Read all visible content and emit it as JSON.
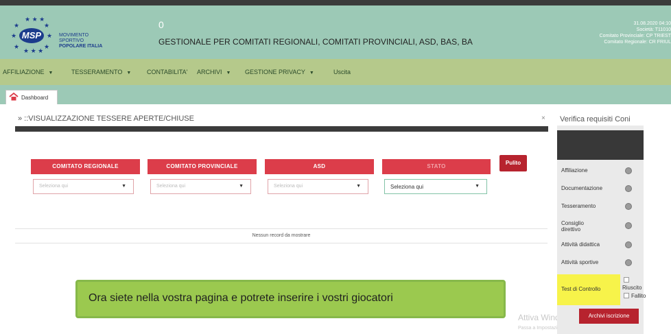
{
  "header": {
    "logo": {
      "mark": "MSP",
      "lines": [
        "MOVIMENTO",
        "SPORTIVO",
        "POPOLARE ITALIA"
      ]
    },
    "count": "0",
    "title": "GESTIONALE PER COMITATI REGIONALI, COMITATI PROVINCIALI, ASD, BAS, BA",
    "right_lines": [
      "31.08.2020 04:10",
      "Società: T11010",
      "Comitato Provinciale: CP TRIEST",
      "Comitato Regionale: CR FRIUL"
    ]
  },
  "nav": {
    "items": [
      {
        "label": "AFFILIAZIONE",
        "caret": "▼"
      },
      {
        "label": "TESSERAMENTO",
        "caret": "▼"
      },
      {
        "label": "CONTABILITA'",
        "caret": ""
      },
      {
        "label": "ARCHIVI",
        "caret": "▼"
      },
      {
        "label": "GESTIONE PRIVACY",
        "caret": "▼"
      },
      {
        "label": "Uscita",
        "caret": ""
      }
    ]
  },
  "tabs": {
    "dashboard": "Dashboard"
  },
  "main": {
    "title": "» ::VISUALIZZAZIONE TESSERE APERTE/CHIUSE",
    "close": "×",
    "filters": [
      {
        "header": "COMITATO REGIONALE",
        "placeholder": "Seleziona qui"
      },
      {
        "header": "COMITATO PROVINCIALE",
        "placeholder": "Seleziona qui"
      },
      {
        "header": "ASD",
        "placeholder": "Seleziona qui"
      },
      {
        "header": "STATO",
        "placeholder": "Seleziona qui"
      }
    ],
    "select_caret": "▼",
    "reset_button": "Pulito",
    "empty_message": "Nessun record da mostrare"
  },
  "tooltip": {
    "text": "Ora siete nella vostra pagina e potrete inserire i vostri giocatori"
  },
  "watermark": {
    "title": "Attiva Windows",
    "subtitle": "Passa a Impostazioni per attivare Windows."
  },
  "sidebar": {
    "title": "Verifica requisiti Coni",
    "requirements": [
      "Affiliazione",
      "Documentazione",
      "Tesseramento",
      "Consiglio direttivo",
      "Attività didattica",
      "Attività sportive"
    ],
    "test": {
      "label": "Test di Controllo",
      "options": [
        "Riuscito",
        "Fallito"
      ]
    },
    "archive_button": "Archivi iscrizione"
  },
  "colors": {
    "header_bg": "#9cc9b6",
    "nav_bg": "#b5c98b",
    "filter_header": "#dc3d4a",
    "button_red": "#b7232e",
    "tooltip_bg": "#9bc94f",
    "test_highlight": "#f7f34a"
  }
}
